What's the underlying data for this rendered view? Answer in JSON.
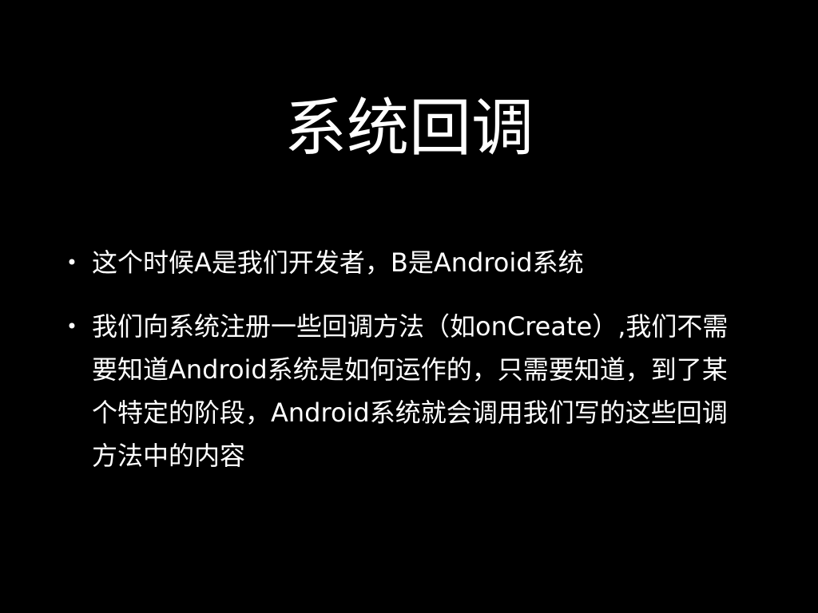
{
  "slide": {
    "title": "系统回调",
    "bullets": [
      {
        "marker": "•",
        "text": "这个时候A是我们开发者，B是Android系统"
      },
      {
        "marker": "•",
        "text": "我们向系统注册一些回调方法（如onCreate）,我们不需要知道Android系统是如何运作的，只需要知道，到了某个特定的阶段，Android系统就会调用我们写的这些回调方法中的内容"
      }
    ]
  },
  "colors": {
    "background": "#000000",
    "text": "#ffffff"
  }
}
